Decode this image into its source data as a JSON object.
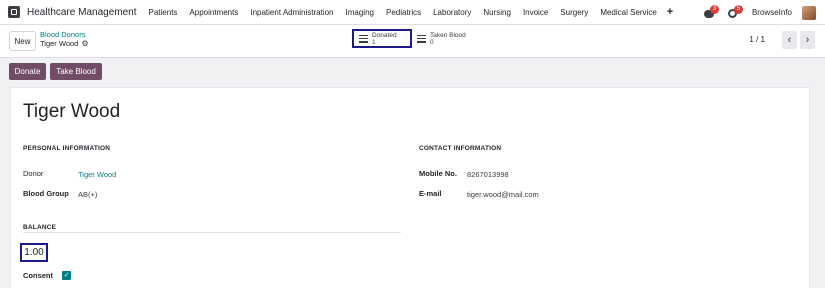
{
  "navbar": {
    "brand": "Healthcare Management",
    "menu": [
      "Patients",
      "Appointments",
      "Inpatient Administration",
      "Imaging",
      "Pediatrics",
      "Laboratory",
      "Nursing",
      "Invoice",
      "Surgery",
      "Medical Service"
    ],
    "plus": "+",
    "chat_badge": "3",
    "activity_badge": "5",
    "user": "BrowseInfo"
  },
  "control": {
    "new_label": "New",
    "breadcrumb_parent": "Blood Donors",
    "breadcrumb_current": "Tiger Wood",
    "smart_buttons": [
      {
        "label": "Donated",
        "count": "1"
      },
      {
        "label": "Taken Blood",
        "count": "0"
      }
    ],
    "pager": "1 / 1"
  },
  "actions": {
    "donate": "Donate",
    "take_blood": "Take Blood"
  },
  "form": {
    "title": "Tiger Wood",
    "personal_title": "PERSONAL INFORMATION",
    "donor_label": "Donor",
    "donor_value": "Tiger Wood",
    "blood_group_label": "Blood Group",
    "blood_group_value": "AB(+)",
    "contact_title": "CONTACT INFORMATION",
    "mobile_label": "Mobile No.",
    "mobile_value": "8267013998",
    "email_label": "E-mail",
    "email_value": "tiger.wood@mail.com",
    "balance_title": "BALANCE",
    "balance_value": "1.00",
    "consent_label": "Consent",
    "consent_checked": true
  },
  "colors": {
    "brand_purple": "#714b67",
    "link_teal": "#017e84",
    "highlight_box": "#1a1a8c",
    "badge_red": "#d43f3a"
  }
}
